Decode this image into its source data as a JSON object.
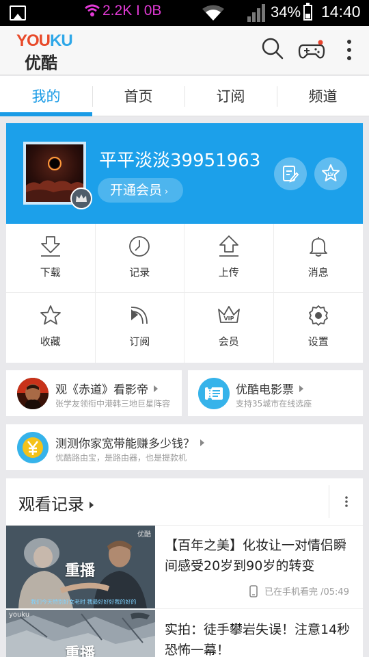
{
  "status_bar": {
    "net_speed": "2.2K I 0B",
    "battery": "34%",
    "time": "14:40"
  },
  "app_bar": {
    "logo_en": {
      "part1": "YOU",
      "part2": "KU"
    },
    "logo_cn": "优酷",
    "icons": [
      "search-icon",
      "gamepad-icon",
      "more-vert-icon"
    ]
  },
  "tabs": [
    {
      "label": "我的",
      "active": true
    },
    {
      "label": "首页",
      "active": false
    },
    {
      "label": "订阅",
      "active": false
    },
    {
      "label": "频道",
      "active": false
    }
  ],
  "profile": {
    "username": "平平淡淡39951963",
    "vip_button": "开通会员",
    "vip_arrow": "›"
  },
  "grid": [
    {
      "label": "下载",
      "icon": "download-icon"
    },
    {
      "label": "记录",
      "icon": "clock-icon"
    },
    {
      "label": "上传",
      "icon": "upload-icon"
    },
    {
      "label": "消息",
      "icon": "bell-icon"
    },
    {
      "label": "收藏",
      "icon": "star-icon"
    },
    {
      "label": "订阅",
      "icon": "rss-icon"
    },
    {
      "label": "会员",
      "icon": "vip-crown-icon"
    },
    {
      "label": "设置",
      "icon": "gear-icon"
    }
  ],
  "promos": [
    {
      "title": "观《赤道》看影帝",
      "subtitle": "张学友领衔中港韩三地巨星阵容"
    },
    {
      "title": "优酷电影票",
      "subtitle": "支持35城市在线选座"
    },
    {
      "title": "测测你家宽带能赚多少钱？",
      "subtitle": "优酷路由宝，是路由器，也是提款机"
    }
  ],
  "history": {
    "title": "观看记录",
    "items": [
      {
        "title": "【百年之美】化妆让一对情侣瞬间感受20岁到90岁的转变",
        "overlay": "重播",
        "watermark": "优酷",
        "caption": "我们今天特别好女老时   我最好好好我的好的",
        "meta": "已在手机看完 /05:49"
      },
      {
        "title": "实拍：徒手攀岩失误！注意14秒恐怖一幕！",
        "overlay": "重播",
        "watermark": "youku"
      }
    ]
  },
  "colors": {
    "accent": "#1a9be6",
    "profile_bg": "#1ca0ea",
    "page_bg": "#e9e9ec",
    "net_speed": "#e23ad6",
    "logo_red": "#e84a2a",
    "logo_blue": "#2ea7e8"
  }
}
